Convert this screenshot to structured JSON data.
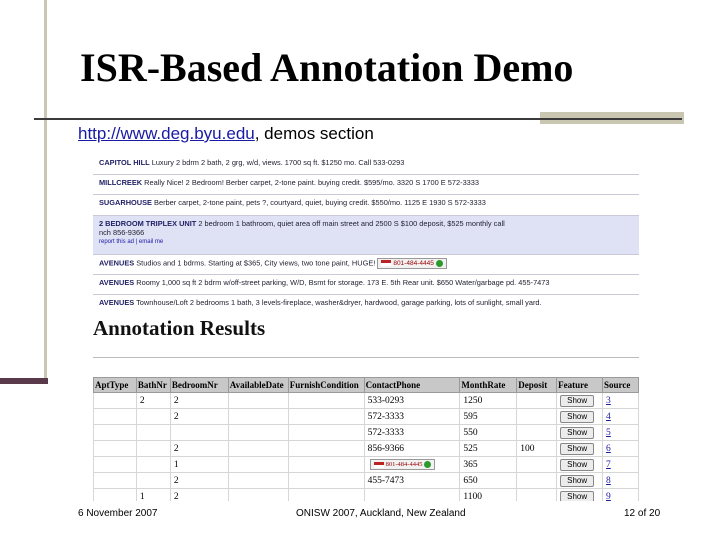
{
  "slide": {
    "title": "ISR-Based Annotation Demo",
    "subtitle_link": "http://www.deg.byu.edu",
    "subtitle_rest": ", demos section"
  },
  "listings": [
    {
      "headline": "CAPITOL HILL",
      "text": " Luxury 2 bdrm 2 bath, 2 grg, w/d, views. 1700 sq ft. $1250 mo. Call 533-0293",
      "selected": false
    },
    {
      "headline": "MILLCREEK",
      "text": " Really Nice! 2 Bedroom! Berber carpet, 2-tone paint. buying credit. $595/mo. 3320 S 1700 E 572-3333",
      "selected": false
    },
    {
      "headline": "SUGARHOUSE",
      "text": " Berber carpet, 2-tone paint, pets ?, courtyard, quiet, buying credit. $550/mo. 1125 E 1930 S 572-3333",
      "selected": false
    },
    {
      "headline": "2 BEDROOM TRIPLEX UNIT",
      "text": " 2 bedroom 1 bathroom, quiet area off main street and 2500 S $100 deposit, $525 monthly call",
      "text2": "nch 856-9366",
      "actions": "report this ad | email me",
      "selected": true
    },
    {
      "headline": "AVENUES",
      "text": " Studios and 1 bdrms. Starting at $365, City views, two tone paint, HUGE!",
      "phone": "801-484-4445",
      "selected": false
    },
    {
      "headline": "AVENUES",
      "text": " Roomy 1,000 sq ft 2 bdrm w/off-street parking, W/D, Bsmt for storage. 173 E. 5th Rear unit. $650 Water/garbage pd. 455-7473",
      "selected": false
    },
    {
      "headline": "AVENUES",
      "text": " Townhouse/Loft 2 bedrooms 1 bath, 3 levels-fireplace, washer&dryer, hardwood, garage parking, lots of sunlight, small yard.",
      "selected": false
    }
  ],
  "results": {
    "heading": "Annotation Results",
    "columns": [
      "AptType",
      "BathNr",
      "BedroomNr",
      "AvailableDate",
      "FurnishCondition",
      "ContactPhone",
      "MonthRate",
      "Deposit",
      "Feature",
      "Source"
    ],
    "rows": [
      {
        "AptType": "",
        "BathNr": "2",
        "BedroomNr": "2",
        "AvailableDate": "",
        "FurnishCondition": "",
        "ContactPhone": "533-0293",
        "MonthRate": "1250",
        "Deposit": "",
        "Feature": "Show",
        "Source": "3"
      },
      {
        "AptType": "",
        "BathNr": "",
        "BedroomNr": "2",
        "AvailableDate": "",
        "FurnishCondition": "",
        "ContactPhone": "572-3333",
        "MonthRate": "595",
        "Deposit": "",
        "Feature": "Show",
        "Source": "4"
      },
      {
        "AptType": "",
        "BathNr": "",
        "BedroomNr": "",
        "AvailableDate": "",
        "FurnishCondition": "",
        "ContactPhone": "572-3333",
        "MonthRate": "550",
        "Deposit": "",
        "Feature": "Show",
        "Source": "5"
      },
      {
        "AptType": "",
        "BathNr": "",
        "BedroomNr": "2",
        "AvailableDate": "",
        "FurnishCondition": "",
        "ContactPhone": "856-9366",
        "MonthRate": "525",
        "Deposit": "100",
        "Feature": "Show",
        "Source": "6"
      },
      {
        "AptType": "",
        "BathNr": "",
        "BedroomNr": "1",
        "AvailableDate": "",
        "FurnishCondition": "",
        "ContactPhone": "801-484-4445",
        "ContactPhoneWidget": true,
        "MonthRate": "365",
        "Deposit": "",
        "Feature": "Show",
        "Source": "7"
      },
      {
        "AptType": "",
        "BathNr": "",
        "BedroomNr": "2",
        "AvailableDate": "",
        "FurnishCondition": "",
        "ContactPhone": "455-7473",
        "MonthRate": "650",
        "Deposit": "",
        "Feature": "Show",
        "Source": "8"
      },
      {
        "AptType": "",
        "BathNr": "1",
        "BedroomNr": "2",
        "AvailableDate": "",
        "FurnishCondition": "",
        "ContactPhone": "",
        "MonthRate": "1100",
        "Deposit": "",
        "Feature": "Show",
        "Source": "9"
      }
    ]
  },
  "footer": {
    "date": "6 November 2007",
    "conference": "ONISW 2007, Auckland, New Zealand",
    "page": "12 of 20"
  }
}
